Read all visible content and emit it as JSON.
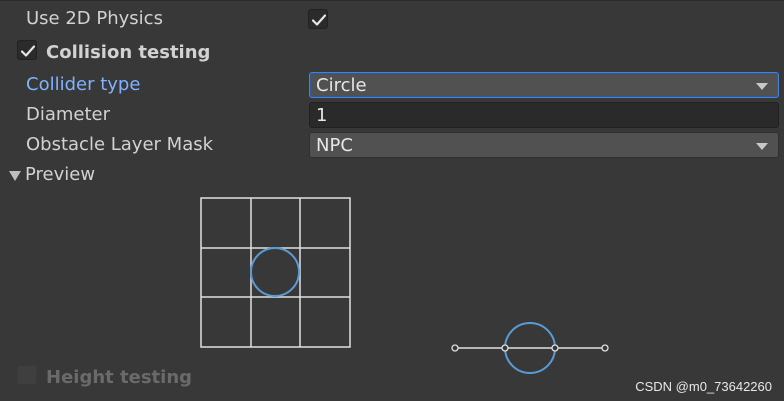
{
  "inspector": {
    "use_2d_physics": {
      "label": "Use 2D Physics",
      "checked": true
    },
    "collision_testing": {
      "label": "Collision testing",
      "checked": true
    },
    "collider_type": {
      "label": "Collider type",
      "value": "Circle"
    },
    "diameter": {
      "label": "Diameter",
      "value": "1"
    },
    "obstacle_layer_mask": {
      "label": "Obstacle Layer Mask",
      "value": "NPC"
    },
    "preview": {
      "label": "Preview",
      "expanded": true
    },
    "height_testing": {
      "label": "Height testing",
      "checked": false,
      "enabled": false
    }
  },
  "watermark": {
    "text": "CSDN @m0_73642260"
  },
  "colors": {
    "background": "#383838",
    "text": "#d2d2d2",
    "active_label": "#7fb2ff",
    "preview_grid": "#e0e0e0",
    "preview_circle": "#5b9bd5"
  },
  "icons": {
    "checkmark": "check-icon",
    "dropdown": "chevron-down-icon",
    "foldout": "triangle-down-icon"
  }
}
